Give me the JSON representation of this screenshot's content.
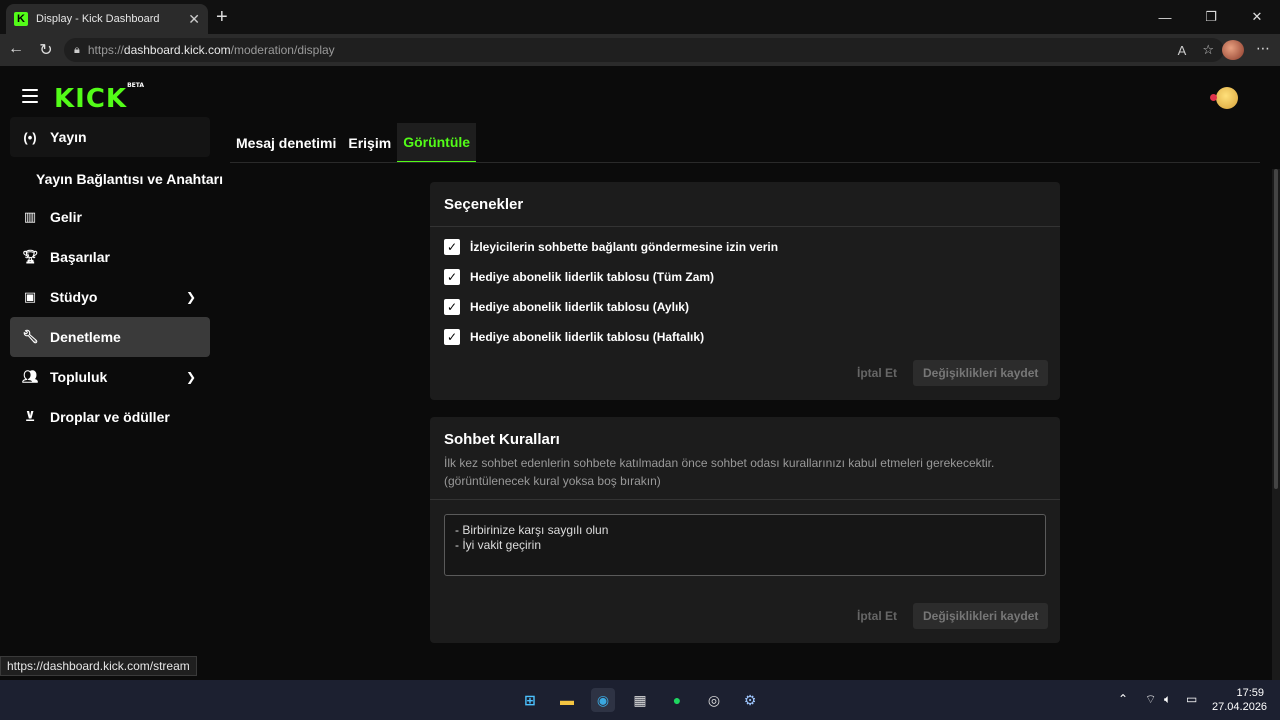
{
  "browser": {
    "tab_title": "Display - Kick Dashboard",
    "tab_favicon": "K",
    "new_tab": "+",
    "url_prefix": "https://",
    "url_host": "dashboard.kick.com",
    "url_path": "/moderation/display",
    "status_url": "https://dashboard.kick.com/stream"
  },
  "header": {
    "logo_text": "KICK",
    "logo_badge": "BETA"
  },
  "sidebar": {
    "items": [
      {
        "label": "Yayın",
        "icon": "broadcast-icon"
      },
      {
        "label": "Gelir",
        "icon": "chart-icon"
      },
      {
        "label": "Başarılar",
        "icon": "trophy-icon"
      },
      {
        "label": "Stüdyo",
        "icon": "studio-icon"
      },
      {
        "label": "Denetleme",
        "icon": "wrench-icon"
      },
      {
        "label": "Topluluk",
        "icon": "community-icon"
      },
      {
        "label": "Droplar ve ödüller",
        "icon": "drops-icon"
      }
    ],
    "sub_item": "Yayın Bağlantısı ve Anahtarı"
  },
  "tabs": [
    "Mesaj denetimi",
    "Erişim",
    "Görüntüle"
  ],
  "options_card": {
    "title": "Seçenekler",
    "checkboxes": [
      "İzleyicilerin sohbette bağlantı göndermesine izin verin",
      "Hediye abonelik liderlik tablosu (Tüm Zam)",
      "Hediye abonelik liderlik tablosu (Aylık)",
      "Hediye abonelik liderlik tablosu (Haftalık)"
    ],
    "cancel": "İptal Et",
    "save": "Değişiklikleri kaydet"
  },
  "rules_card": {
    "title": "Sohbet Kuralları",
    "desc1": "İlk kez sohbet edenlerin sohbete katılmadan önce sohbet odası kurallarınızı kabul etmeleri gerekecektir.",
    "desc2": "(görüntülenecek kural yoksa boş bırakın)",
    "rules_text": "- Birbirinize karşı saygılı olun\n- İyi vakit geçirin",
    "cancel": "İptal Et",
    "save": "Değişiklikleri kaydet"
  },
  "taskbar": {
    "time": "17:59",
    "date": "27.04.2026"
  },
  "colors": {
    "accent": "#53fc18",
    "bg": "#0b0b0b",
    "card": "#1c1c1c"
  }
}
